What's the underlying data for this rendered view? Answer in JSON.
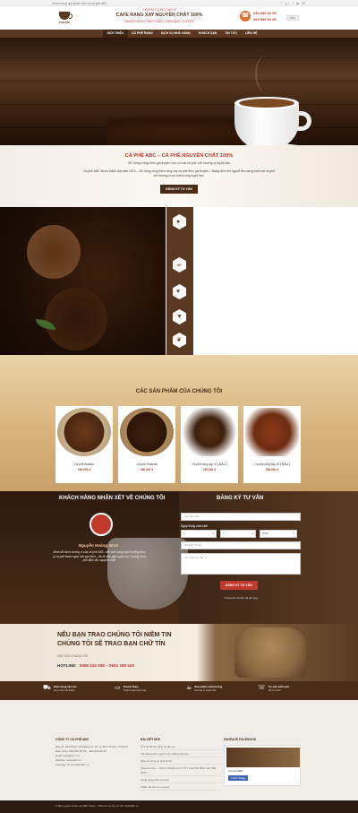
{
  "topbar": {
    "left_text": "Chào mừng quý khách đến với cà phê ABC",
    "social": "f g+ t ▶ ✉"
  },
  "header": {
    "logo_text": "COFFEE",
    "slogan_top": "CHUYÊN CUNG CẤP SỈ",
    "slogan_main": "CAFE RANG XAY NGUYÊN CHẤT 100%",
    "slogan_bottom": "RANG KHOẢI TINH THẦN CÙNG ABC COFFEE",
    "phone1": "094 999 92 95",
    "phone2": "094 999 92 95",
    "lang": "VI ▾"
  },
  "nav": {
    "items": [
      "GIỚI THIỆU",
      "CÀ PHÊ RANG",
      "DỊCH VỤ NHÀ HÀNG",
      "KHÁCH SẠN",
      "TIN TỨC",
      "LIÊN HỆ"
    ]
  },
  "intro": {
    "title": "CÀ PHÊ ABC – CÀ PHÊ NGUYÊN CHẤT 100%",
    "subtitle": "Sử dụng công thức gia truyền cho ra loại cà phê với hương vị tuyệt hảo",
    "desc": "Cà phê ABC được thành lập năm 2013 – Sử dụng công thức rang xay cà phê theo gia truyền – Mang đến cho người tiêu dùng một loại cà phê với hương vị và chất lượng tuyệt hảo.",
    "button": "ĐĂNG KÝ TƯ VẤN"
  },
  "features": {
    "icons": [
      "bean-icon",
      "cup-icon",
      "heart-icon",
      "drop-icon",
      "leaf-icon"
    ]
  },
  "products": {
    "title": "CÁC SẢN PHẨM CỦA CHÚNG TÔI",
    "items": [
      {
        "name": "Cà phê Arabica",
        "price": "156.209 đ"
      },
      {
        "name": "Cà phê Robusta",
        "price": "250.000 đ"
      },
      {
        "name": "Cà phê rang xay 01 [ MẪU ]",
        "price": "250.000 đ"
      },
      {
        "name": "Cà phê rang xay 02 [ MẪU ]",
        "price": "250.000 đ"
      }
    ]
  },
  "testimonial": {
    "title": "KHÁCH HÀNG NHẬN XÉT VỀ CHÚNG TÔI",
    "name": "Nguyễn Hoàng Minh",
    "quote": "Mình rất thích hương vị của cà phê ABC, mỗi buổi sáng ngồi thưởng thức ly cà phê thơm ngon bên gia đình – đó là cảm giác tuyệt vời. Hương vị cà phê đậm đà, nguyên chất."
  },
  "contact": {
    "title": "ĐĂNG KÝ TƯ VẤN",
    "name_placeholder": "Tên bạn bạn",
    "dob_label": "Ngày tháng năm sinh",
    "day": "1",
    "month": "1",
    "year": "2000",
    "phone_placeholder": "Số Điện Thoại",
    "msg_placeholder": "Lời nhắn từ của, ví...",
    "button": "ĐĂNG KÝ TƯ VẤN",
    "note": "*Chúng tôi sẽ liên hệ lại ngay"
  },
  "trust": {
    "title1": "NẾU BẠN TRAO CHÚNG TÔI NIỀM TIN",
    "title2": "CHÚNG TÔI SẼ TRAO BẠN CHỮ TÍN",
    "cta": "HÃY GỌI CHÚNG TÔI",
    "hotline_label": "HOTLINE:",
    "hotline": "0968 243 068 – 0931 389 626"
  },
  "services": [
    {
      "title": "Giao hàng tận nơi",
      "desc": "Free ship nội thành"
    },
    {
      "title": "Thanh Toán",
      "desc": "Thanh toán linh hoạt"
    },
    {
      "title": "Sản phẩm chất lượng",
      "desc": "Hương vị tuyệt hảo"
    },
    {
      "title": "Tư vấn miễn phí",
      "desc": "Hỗ trợ 24/7"
    }
  ],
  "footer": {
    "company_title": "CÔNG TY CÀ PHÊ ABC",
    "address": "Địa chỉ: 269 Phạm Văn Đồng, P. 15, Q. Bình Thạnh, TP.HCM",
    "phone": "Điện thoại: 094 999 92 95 – 094 999 92 95",
    "email": "Email: abc@com.vn",
    "website": "Website: www.abc.vn",
    "fanpage": "Fanpage: fb.com/webabc.vn",
    "posts_title": "BÀI VIẾT MỚI",
    "posts": [
      "Ăn loại đồ ăn uống cà độ lưu",
      "Tác dụng kinh người của những loại hạt",
      "Quả cà chua có phải là tốt",
      "Quả cà chua – THỰC PHẨM CỰC TỐT CHO BÀ BẦU VÀ TRẺ NHỎ",
      "Công dụng của trà xanh",
      "Chăm tốt cho mọi người"
    ],
    "fb_title": "FANPAGE FACEBOOK",
    "fb_name": "Cà phê ABC",
    "fb_like": "Thích Trang"
  },
  "copyright": "© Bản quyền thuộc về ABC Team - Thiết kế và duy trì bởi WebABC.vn",
  "colors": {
    "brown": "#5a3821",
    "red": "#c0392b",
    "gold": "#d8b47c"
  }
}
